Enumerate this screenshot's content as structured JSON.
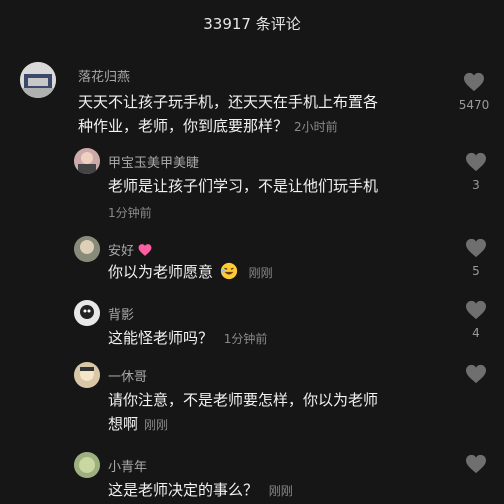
{
  "header": {
    "title": "33917 条评论"
  },
  "comments": [
    {
      "user": "落花归燕",
      "text_line1": "天天不让孩子玩手机，还天天在手机上布置各",
      "text_line2": "种作业，老师，你到底要那样？",
      "time": "2小时前",
      "likes": "5470"
    },
    {
      "user": "甲宝玉美甲美睫",
      "text": "老师是让孩子们学习，不是让他们玩手机",
      "time": "1分钟前",
      "likes": "3"
    },
    {
      "user": "安好",
      "text": "你以为老师愿意",
      "time": "刚刚",
      "likes": "5"
    },
    {
      "user": "背影",
      "text": "这能怪老师吗？",
      "time": "1分钟前",
      "likes": "4"
    },
    {
      "user": "一休哥",
      "text_line1": "请你注意，不是老师要怎样，你以为老师",
      "text_line2": "想啊",
      "time": "刚刚",
      "likes": ""
    },
    {
      "user": "小青年",
      "text": "这是老师决定的事么？",
      "time": "刚刚",
      "likes": ""
    }
  ],
  "icons": {
    "like": "heart-icon",
    "emoji_heart": "pink-heart-emoji",
    "emoji_laugh": "laughing-face-emoji"
  },
  "colors": {
    "background": "#161616",
    "heart": "#6f6f6f",
    "username": "#a8a8a8",
    "meta": "#8a8a8a"
  }
}
